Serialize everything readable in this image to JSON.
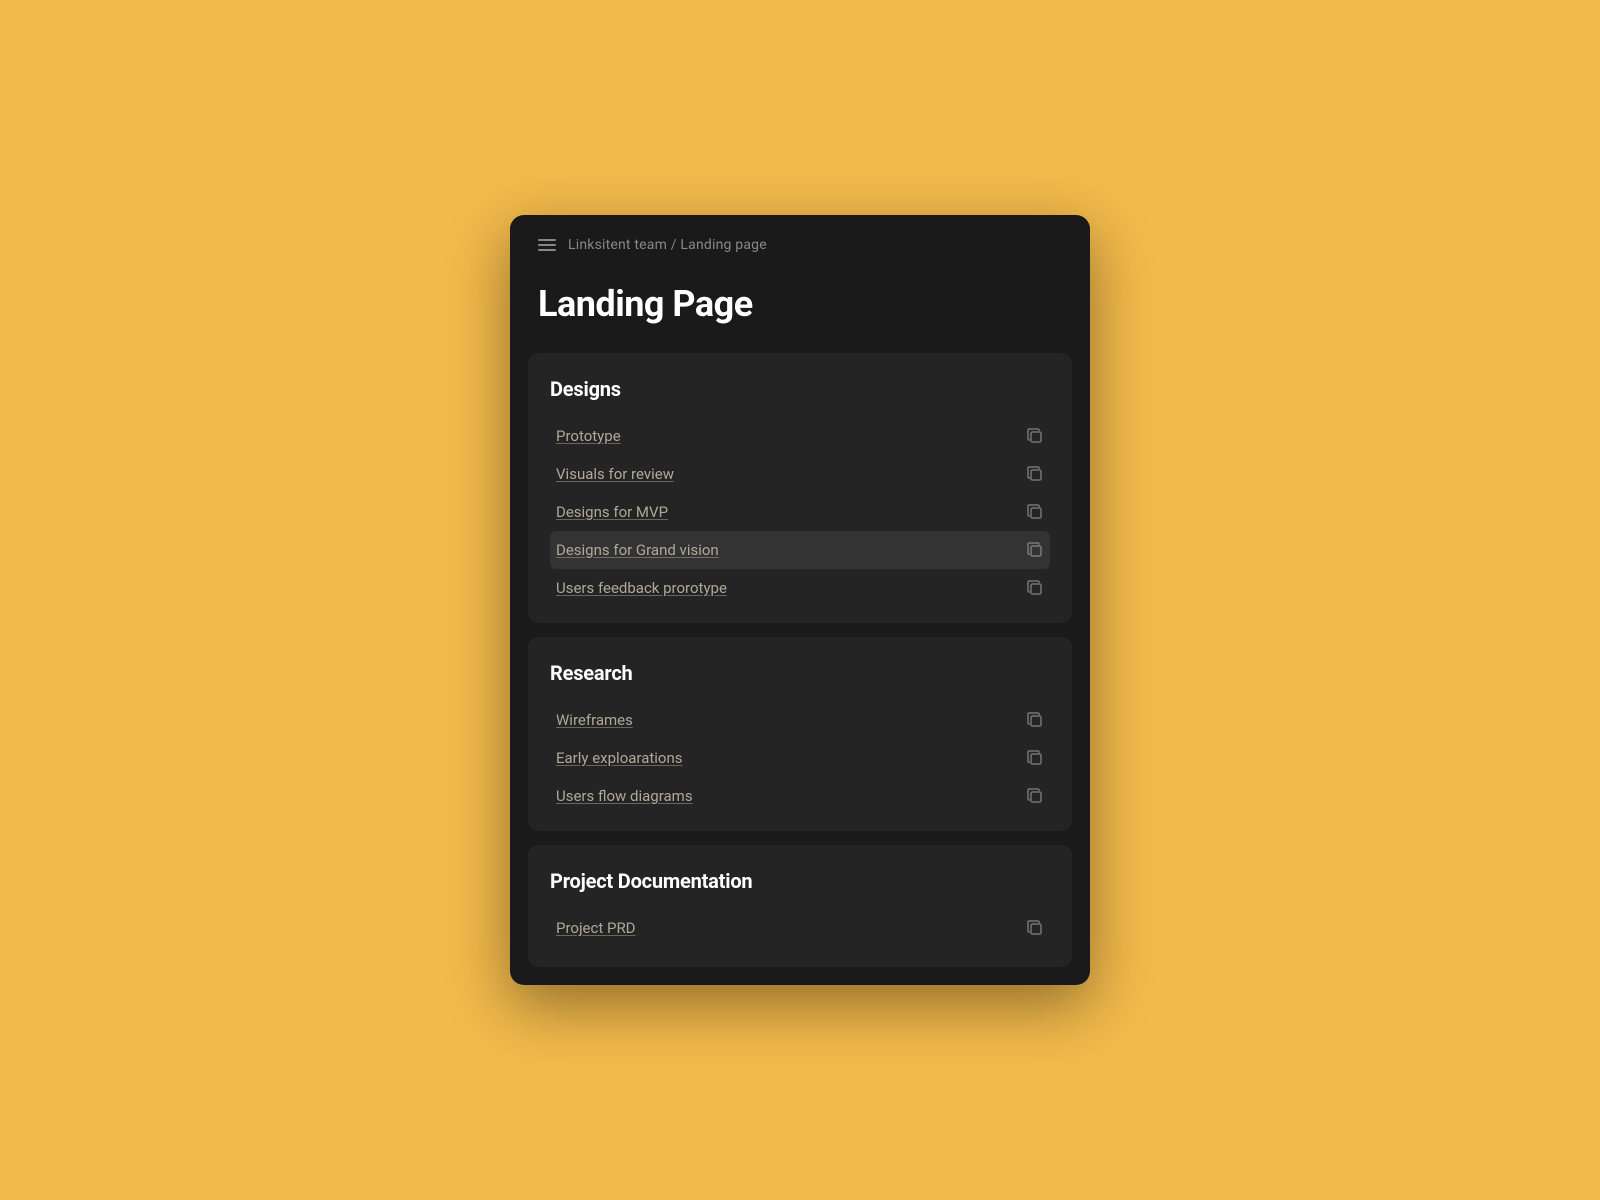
{
  "breadcrumb": {
    "text": "Linksitent team / Landing page"
  },
  "pageTitle": "Landing Page",
  "sections": [
    {
      "id": "designs",
      "title": "Designs",
      "items": [
        {
          "id": "prototype",
          "label": "Prototype",
          "highlighted": false
        },
        {
          "id": "visuals-for-review",
          "label": "Visuals for review",
          "highlighted": false
        },
        {
          "id": "designs-for-mvp",
          "label": "Designs for MVP",
          "highlighted": false
        },
        {
          "id": "designs-for-grand-vision",
          "label": "Designs for Grand vision",
          "highlighted": true
        },
        {
          "id": "users-feedback-prototype",
          "label": "Users feedback prorotype",
          "highlighted": false
        }
      ]
    },
    {
      "id": "research",
      "title": "Research",
      "items": [
        {
          "id": "wireframes",
          "label": "Wireframes",
          "highlighted": false
        },
        {
          "id": "early-explorations",
          "label": "Early exploarations",
          "highlighted": false
        },
        {
          "id": "users-flow-diagrams",
          "label": "Users flow diagrams",
          "highlighted": false
        }
      ]
    },
    {
      "id": "project-documentation",
      "title": "Project Documentation",
      "items": [
        {
          "id": "project-prd",
          "label": "Project PRD",
          "highlighted": false
        }
      ]
    }
  ],
  "hamburgerIcon": "≡"
}
